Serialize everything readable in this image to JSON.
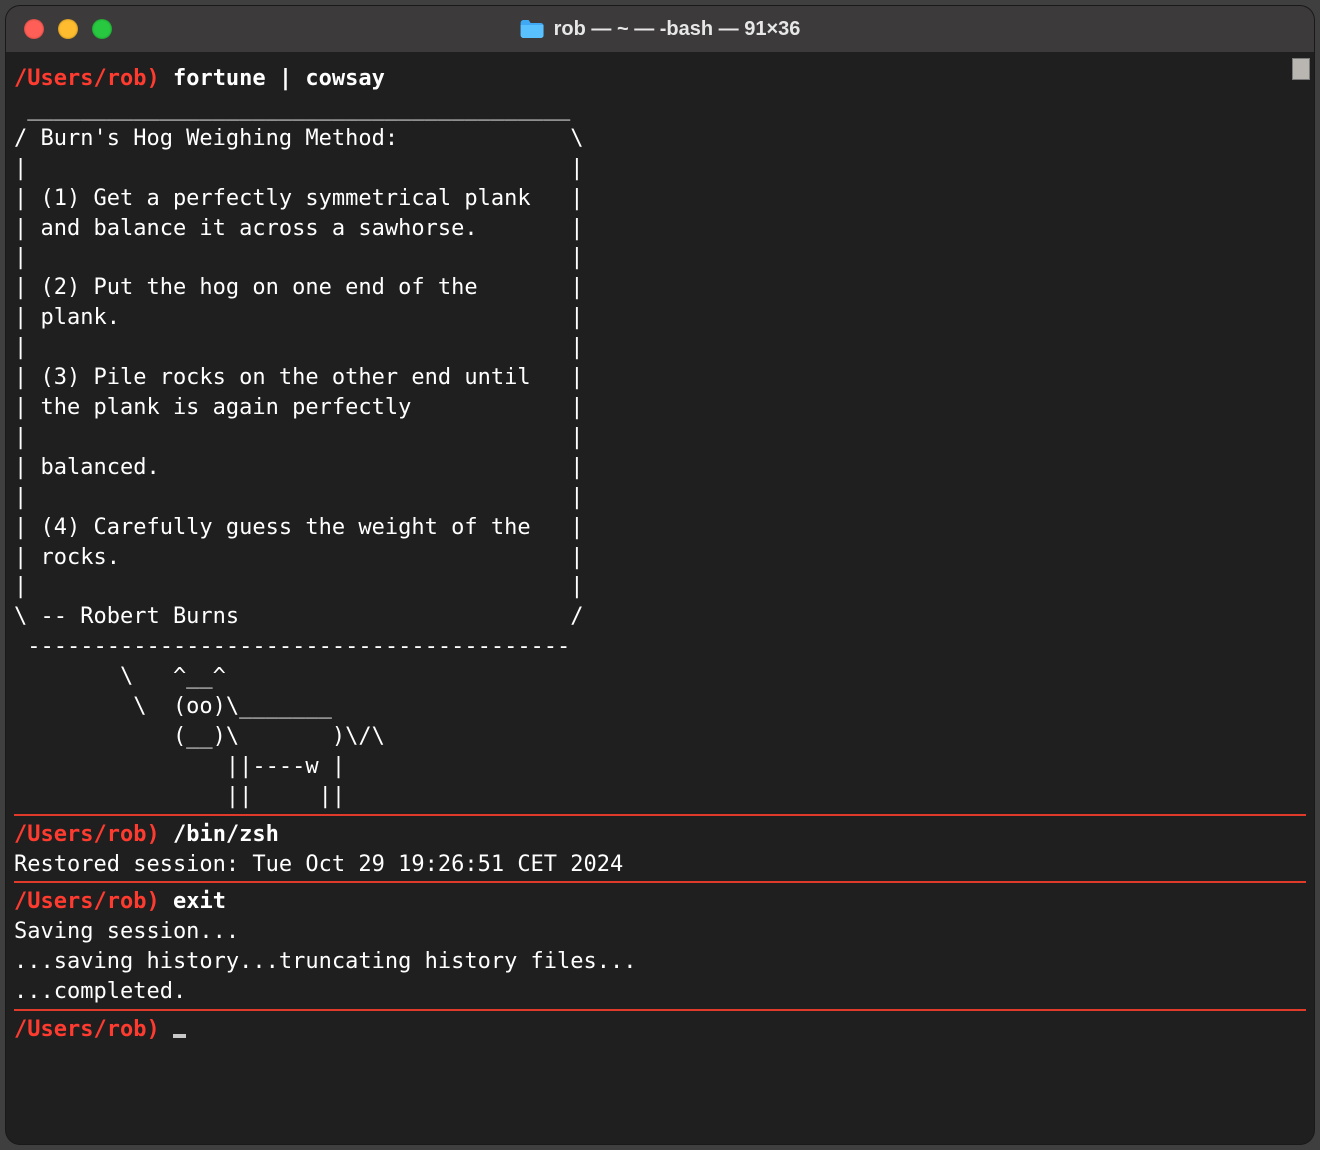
{
  "window": {
    "title": "rob — ~ — -bash — 91×36"
  },
  "blocks": [
    {
      "prompt": "/Users/rob)",
      "command": "fortune | cowsay",
      "output": [
        " _________________________________________",
        "/ Burn's Hog Weighing Method:             \\",
        "|                                         |",
        "| (1) Get a perfectly symmetrical plank   |",
        "| and balance it across a sawhorse.       |",
        "|                                         |",
        "| (2) Put the hog on one end of the       |",
        "| plank.                                  |",
        "|                                         |",
        "| (3) Pile rocks on the other end until   |",
        "| the plank is again perfectly            |",
        "|                                         |",
        "| balanced.                               |",
        "|                                         |",
        "| (4) Carefully guess the weight of the   |",
        "| rocks.                                  |",
        "|                                         |",
        "\\ -- Robert Burns                         /",
        " -----------------------------------------",
        "        \\   ^__^",
        "         \\  (oo)\\_______",
        "            (__)\\       )\\/\\",
        "                ||----w |",
        "                ||     ||"
      ]
    },
    {
      "prompt": "/Users/rob)",
      "command": "/bin/zsh",
      "output": [
        "Restored session: Tue Oct 29 19:26:51 CET 2024"
      ]
    },
    {
      "prompt": "/Users/rob)",
      "command": "exit",
      "output": [
        "",
        "Saving session...",
        "...saving history...truncating history files...",
        "...completed."
      ]
    }
  ],
  "final_prompt": "/Users/rob)"
}
